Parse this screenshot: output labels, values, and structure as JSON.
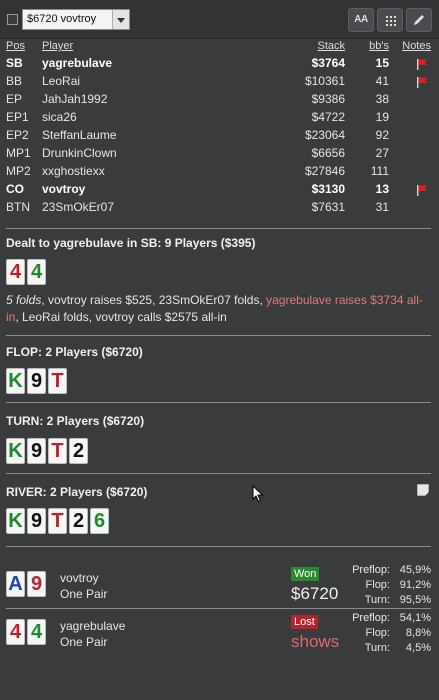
{
  "toolbar": {
    "hand_select_value": "$6720 vovtroy",
    "aa_label": "AA"
  },
  "table_headers": {
    "pos": "Pos",
    "player": "Player",
    "stack": "Stack",
    "bbs": "bb's",
    "notes": "Notes"
  },
  "players": [
    {
      "pos": "SB",
      "name": "yagrebulave",
      "stack": "$3764",
      "bbs": "15",
      "bold": true,
      "flag": true
    },
    {
      "pos": "BB",
      "name": "LeoRai",
      "stack": "$10361",
      "bbs": "41",
      "bold": false,
      "flag": true
    },
    {
      "pos": "EP",
      "name": "JahJah1992",
      "stack": "$9386",
      "bbs": "38",
      "bold": false,
      "flag": false
    },
    {
      "pos": "EP1",
      "name": "sica26",
      "stack": "$4722",
      "bbs": "19",
      "bold": false,
      "flag": false
    },
    {
      "pos": "EP2",
      "name": "SteffanLaume",
      "stack": "$23064",
      "bbs": "92",
      "bold": false,
      "flag": false
    },
    {
      "pos": "MP1",
      "name": "DrunkinClown",
      "stack": "$6656",
      "bbs": "27",
      "bold": false,
      "flag": false
    },
    {
      "pos": "MP2",
      "name": "xxghostiexx",
      "stack": "$27846",
      "bbs": "111",
      "bold": false,
      "flag": false
    },
    {
      "pos": "CO",
      "name": "vovtroy",
      "stack": "$3130",
      "bbs": "13",
      "bold": true,
      "flag": true
    },
    {
      "pos": "BTN",
      "name": "23SmOkEr07",
      "stack": "$7631",
      "bbs": "31",
      "bold": false,
      "flag": false
    }
  ],
  "preflop": {
    "title": "Dealt to yagrebulave in SB: 9 Players ($395)",
    "hole_cards": [
      {
        "rank": "4",
        "suit": "red"
      },
      {
        "rank": "4",
        "suit": "green"
      }
    ],
    "actions_italic": "5 folds",
    "actions_1": ", vovtroy raises $525, 23SmOkEr07 folds, ",
    "actions_hero": "yagrebulave raises $3734 all-in",
    "actions_2": ", LeoRai folds, vovtroy calls $2575 all-in"
  },
  "flop": {
    "title": "FLOP: 2 Players ($6720)",
    "cards": [
      {
        "rank": "K",
        "suit": "green"
      },
      {
        "rank": "9",
        "suit": "black"
      },
      {
        "rank": "T",
        "suit": "red"
      }
    ]
  },
  "turn": {
    "title": "TURN: 2 Players ($6720)",
    "cards": [
      {
        "rank": "K",
        "suit": "green"
      },
      {
        "rank": "9",
        "suit": "black"
      },
      {
        "rank": "T",
        "suit": "red"
      },
      {
        "rank": "2",
        "suit": "black"
      }
    ]
  },
  "river": {
    "title": "RIVER: 2 Players ($6720)",
    "cards": [
      {
        "rank": "K",
        "suit": "green"
      },
      {
        "rank": "9",
        "suit": "black"
      },
      {
        "rank": "T",
        "suit": "red"
      },
      {
        "rank": "2",
        "suit": "black"
      },
      {
        "rank": "6",
        "suit": "green"
      }
    ]
  },
  "results": [
    {
      "name": "vovtroy",
      "hand": "One Pair",
      "badge": "Won",
      "amount": "$6720",
      "status": "won",
      "cards": [
        {
          "rank": "A",
          "suit": "blue"
        },
        {
          "rank": "9",
          "suit": "red"
        }
      ],
      "equity": [
        {
          "label": "Preflop:",
          "value": "45,9%"
        },
        {
          "label": "Flop:",
          "value": "91,2%"
        },
        {
          "label": "Turn:",
          "value": "95,5%"
        }
      ]
    },
    {
      "name": "yagrebulave",
      "hand": "One Pair",
      "badge": "Lost",
      "amount": "shows",
      "status": "lost",
      "cards": [
        {
          "rank": "4",
          "suit": "red"
        },
        {
          "rank": "4",
          "suit": "green"
        }
      ],
      "equity": [
        {
          "label": "Preflop:",
          "value": "54,1%"
        },
        {
          "label": "Flop:",
          "value": "8,8%"
        },
        {
          "label": "Turn:",
          "value": "4,5%"
        }
      ]
    }
  ],
  "colors": {
    "background": "#3a3b3d",
    "hero_text": "#e07a78",
    "won": "#2b8a2e",
    "lost": "#b3232a"
  }
}
